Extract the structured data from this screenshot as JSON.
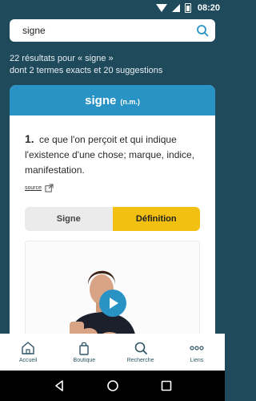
{
  "status": {
    "time": "08:20"
  },
  "search": {
    "value": "signe"
  },
  "results": {
    "line1": "22 résultats pour « signe »",
    "line2": "dont 2 termes exacts et 20 suggestions"
  },
  "entry": {
    "word": "signe",
    "pos": "(n.m.)",
    "number": "1.",
    "definition": "ce que l'on perçoit et qui indique l'existence d'une chose; marque, indice, manifestation.",
    "source_label": "source"
  },
  "toggle": {
    "option1": "Signe",
    "option2": "Définition",
    "selected": "Définition"
  },
  "nav": {
    "items": [
      {
        "label": "Accueil",
        "icon": "home-icon"
      },
      {
        "label": "Boutique",
        "icon": "bag-icon"
      },
      {
        "label": "Recherche",
        "icon": "search-icon"
      },
      {
        "label": "Liens",
        "icon": "more-icon"
      }
    ]
  },
  "colors": {
    "header": "#2a93c6",
    "accent": "#f2c010",
    "background": "#1f4a5c"
  }
}
